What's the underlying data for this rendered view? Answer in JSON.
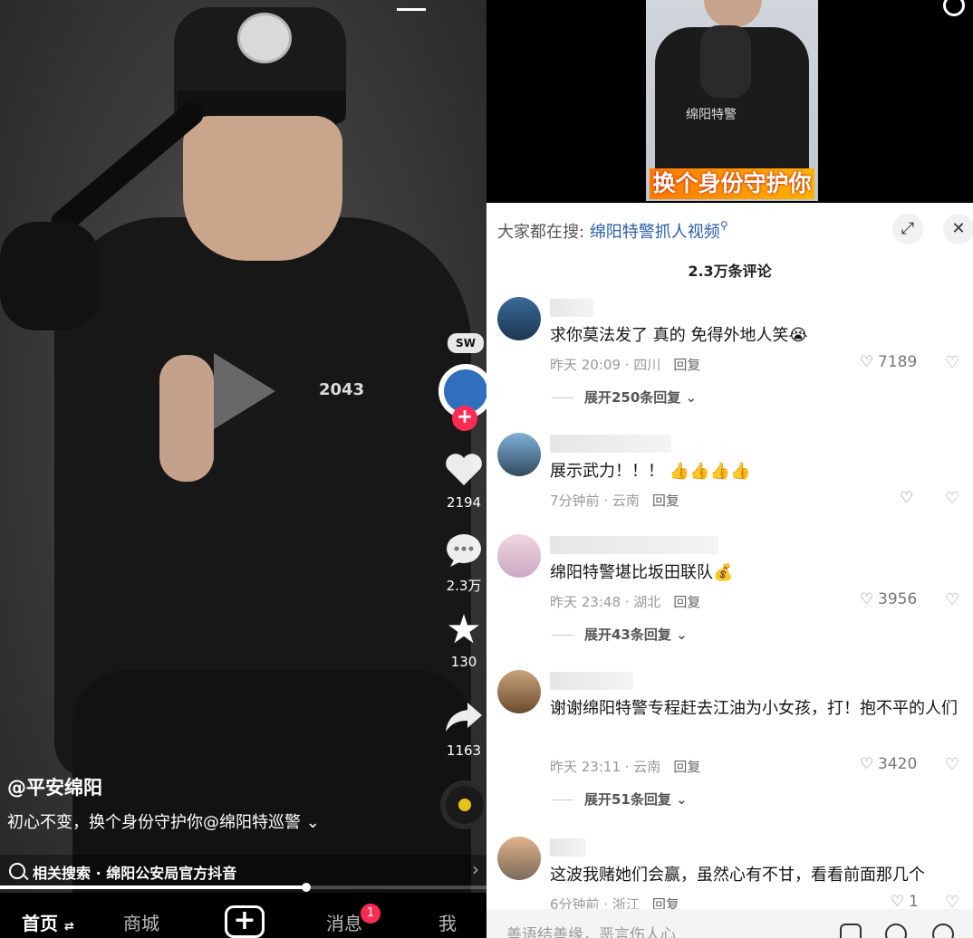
{
  "left_video": {
    "author": "@平安绵阳",
    "description": "初心不变，换个身份守护你@绵阳特巡警",
    "vest_number": "2043",
    "patch_text": "SW",
    "likes": "2194",
    "comments": "2.3万",
    "favorites": "130",
    "shares": "1163",
    "related_search": "相关搜索 · 绵阳公安局官方抖音",
    "progress": 0.63,
    "nav": {
      "home": "首页",
      "mall": "商城",
      "plus": "+",
      "messages": "消息",
      "messages_badge": "1",
      "me": "我"
    }
  },
  "right_panel": {
    "thumbnail_caption": "换个身份守护你",
    "thumbnail_vest_text": "绵阳特警",
    "hot_search_label": "大家都在搜:",
    "hot_search_keyword": "绵阳特警抓人视频",
    "comment_count": "2.3万条评论",
    "comments": [
      {
        "text": "求你莫法发了 真的  免得外地人笑😭",
        "time": "昨天 20:09 · 四川",
        "reply": "回复",
        "likes": "7189",
        "expand": "展开250条回复"
      },
      {
        "text": "展示武力！！！ 👍👍👍👍",
        "time": "7分钟前 · 云南",
        "reply": "回复",
        "likes": "",
        "expand": ""
      },
      {
        "text": "绵阳特警堪比坂田联队💰",
        "time": "昨天 23:48 · 湖北",
        "reply": "回复",
        "likes": "3956",
        "expand": "展开43条回复"
      },
      {
        "text": "谢谢绵阳特警专程赶去江油为小女孩，打！抱不平的人们",
        "time": "昨天 23:11 · 云南",
        "reply": "回复",
        "likes": "3420",
        "expand": "展开51条回复"
      },
      {
        "text": "这波我赌她们会赢，虽然心有不甘，看看前面那几个",
        "time": "6分钟前 · 浙江",
        "reply": "回复",
        "likes": "1",
        "expand": ""
      }
    ],
    "input_placeholder": "善语结善缘，恶言伤人心"
  },
  "colors": {
    "accent": "#fe2c55",
    "link": "#2b5da8"
  }
}
